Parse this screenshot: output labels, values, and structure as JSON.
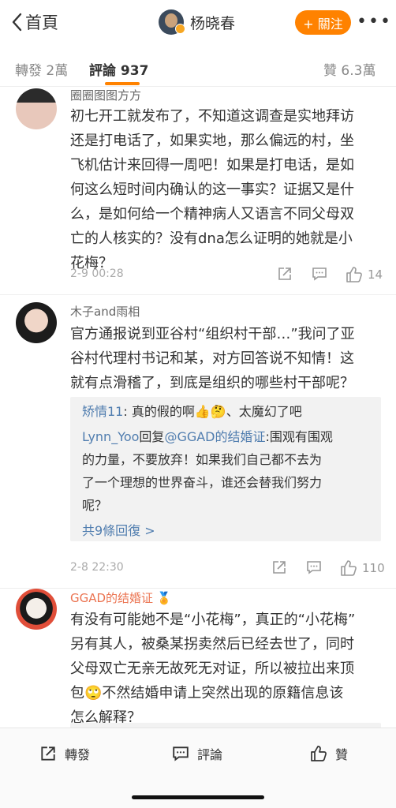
{
  "header": {
    "back_label": "首頁",
    "user_name": "杨晓春",
    "follow_label": "+ 關注",
    "more": "•••"
  },
  "tabs": {
    "repost": "轉發 2萬",
    "comment": "評論 937",
    "like": "贊 6.3萬"
  },
  "comments": [
    {
      "user": "圈圈图图方方",
      "lines": [
        "初七开工就发布了，不知道这调查是实地拜访",
        "还是打电话了，如果实地，那么偏远的村，坐",
        "飞机估计来回得一周吧！如果是打电话，是如",
        "何这么短时间内确认的这一事实？证据又是什",
        "么，是如何给一个精神病人又语言不同父母双",
        "亡的人核实的？没有dna怎么证明的她就是小",
        "花梅？"
      ],
      "date": "2-9 00:28",
      "likes": "14"
    },
    {
      "user": "木子and雨相",
      "lines": [
        "官方通报说到亚谷村“组织村干部…”我问了亚",
        "谷村代理村书记和某，对方回答说不知情！这",
        "就有点滑稽了，到底是组织的哪些村干部呢？"
      ],
      "replies": {
        "r1_user": "矫情11",
        "r1_text": ": 真的假的啊👍🤔、太魔幻了吧",
        "r2_user": "Lynn_Yoo",
        "r2_mid": "回复",
        "r2_target": "@GGAD的结婚证",
        "r2_l1": ":围观有围观",
        "r2_l2": "的力量，不要放弃！如果我们自己都不去为",
        "r2_l3": "了一个理想的世界奋斗，谁还会替我们努力",
        "r2_l4": "呢？",
        "more": "共9條回復 >"
      },
      "date": "2-8 22:30",
      "likes": "110"
    },
    {
      "user": "GGAD的结婚证 🏅",
      "lines": [
        "有没有可能她不是“小花梅”，真正的“小花梅”",
        "另有其人，被桑某拐卖然后已经去世了，同时",
        "父母双亡无亲无故死无对证，所以被拉出来顶",
        "包🙄不然结婚申请上突然出现的原籍信息该",
        "怎么解释？"
      ]
    }
  ],
  "bottom_bar": {
    "repost": "轉發",
    "comment": "評論",
    "like": "贊"
  },
  "colors": {
    "accent": "#ff8200",
    "link": "#507daf",
    "username_highlight": "#eb7350"
  }
}
